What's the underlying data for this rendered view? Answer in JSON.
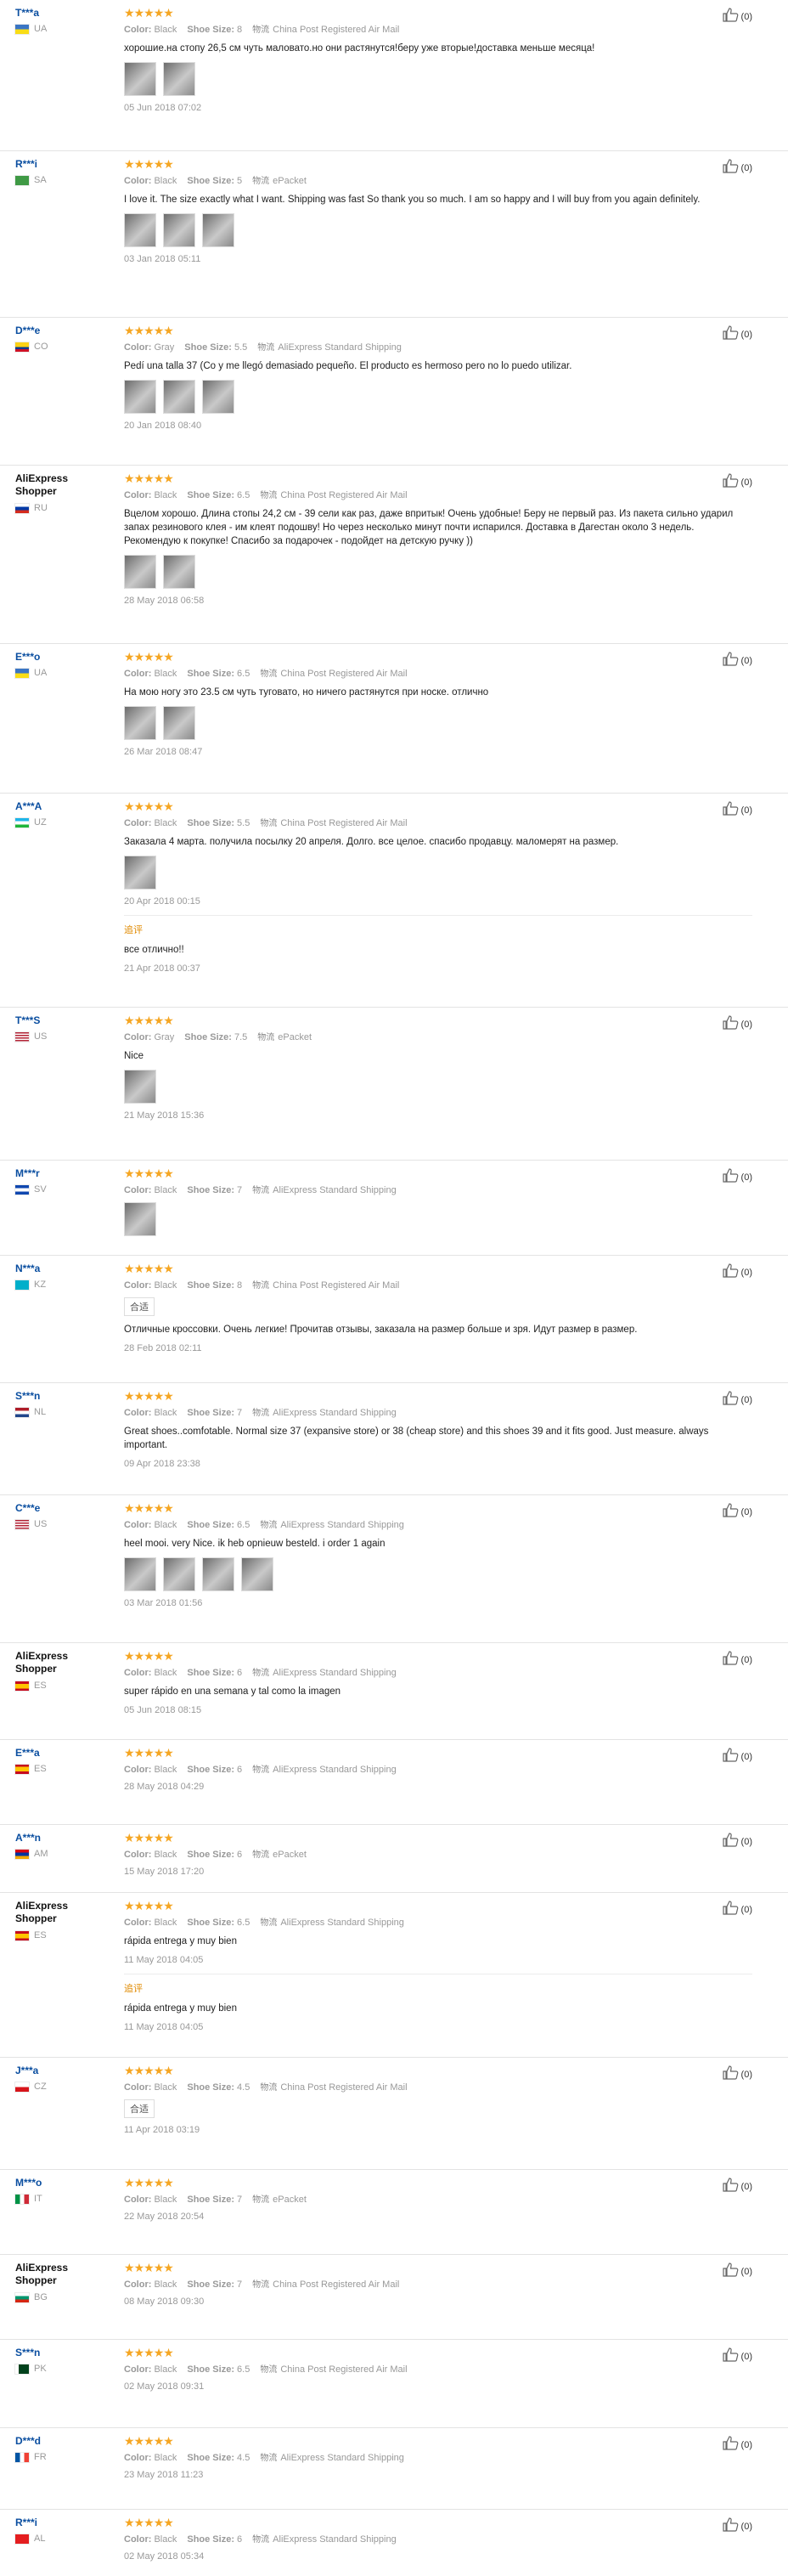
{
  "labels": {
    "color": "Color:",
    "size": "Shoe Size:",
    "ship_icon": "物流",
    "additional": "追评",
    "like_count": "(0)"
  },
  "colors": {
    "star": "#f5a623",
    "user_link": "#0a4ea0",
    "meta": "#999999"
  },
  "reviews": [
    {
      "user": "T***a",
      "country": "UA",
      "flag": "ua",
      "color": "Black",
      "size": "8",
      "shipping": "China Post Registered Air Mail",
      "text": "хорошие.на стопу 26,5 см чуть маловато.но они растянутся!беру уже вторые!доставка меньше месяца!",
      "photos": 2,
      "date": "05 Jun 2018 07:02"
    },
    {
      "user": "R***i",
      "country": "SA",
      "flag": "sa",
      "color": "Black",
      "size": "5",
      "shipping": "ePacket",
      "text": "I love it. The size exactly what I want. Shipping was fast So thank you so much. I am so happy and I will buy from you again definitely.",
      "photos": 3,
      "date": "03 Jan 2018 05:11"
    },
    {
      "user": "D***e",
      "country": "CO",
      "flag": "co",
      "color": "Gray",
      "size": "5.5",
      "shipping": "AliExpress Standard Shipping",
      "text": "Pedí una talla 37 (Co y me llegó demasiado pequeño. El producto es hermoso pero no lo puedo utilizar.",
      "photos": 3,
      "date": "20 Jan 2018 08:40"
    },
    {
      "user": "AliExpress Shopper",
      "country": "RU",
      "flag": "ru",
      "color": "Black",
      "size": "6.5",
      "shipping": "China Post Registered Air Mail",
      "text": "Вцелом хорошо. Длина стопы 24,2 см - 39 сели как раз, даже впритык! Очень удобные! Беру не первый раз. Из пакета сильно ударил запах резинового клея - им клеят подошву! Но через несколько минут почти испарился. Доставка в Дагестан около 3 недель. Рекомендую к покупке! Спасибо за подарочек - подойдет на детскую ручку ))",
      "photos": 2,
      "date": "28 May 2018 06:58"
    },
    {
      "user": "E***o",
      "country": "UA",
      "flag": "ua",
      "color": "Black",
      "size": "6.5",
      "shipping": "China Post Registered Air Mail",
      "text": "На мою ногу это 23.5 см чуть туговато, но ничего растянутся при носке. отлично",
      "photos": 2,
      "date": "26 Mar 2018 08:47"
    },
    {
      "user": "A***A",
      "country": "UZ",
      "flag": "uz",
      "color": "Black",
      "size": "5.5",
      "shipping": "China Post Registered Air Mail",
      "text": "Заказала 4 марта. получила посылку 20 апреля. Долго. все целое. спасибо продавцу. маломерят на размер.",
      "photos": 1,
      "date": "20 Apr 2018 00:15",
      "additional_text": "все отлично!!",
      "additional_date": "21 Apr 2018 00:37"
    },
    {
      "user": "T***S",
      "country": "US",
      "flag": "us",
      "color": "Gray",
      "size": "7.5",
      "shipping": "ePacket",
      "text": "Nice",
      "photos": 1,
      "date": "21 May 2018 15:36"
    },
    {
      "user": "M***r",
      "country": "SV",
      "flag": "sv",
      "color": "Black",
      "size": "7",
      "shipping": "AliExpress Standard Shipping",
      "text": "",
      "photos": 1,
      "date": ""
    },
    {
      "user": "N***a",
      "country": "KZ",
      "flag": "kz",
      "color": "Black",
      "size": "8",
      "shipping": "China Post Registered Air Mail",
      "tag": "合适",
      "text": "Отличные кроссовки. Очень легкие! Прочитав отзывы, заказала на размер больше и зря. Идут размер в размер.",
      "photos": 0,
      "date": "28 Feb 2018 02:11"
    },
    {
      "user": "S***n",
      "country": "NL",
      "flag": "nl",
      "color": "Black",
      "size": "7",
      "shipping": "AliExpress Standard Shipping",
      "text": "Great shoes..comfotable. Normal size 37 (expansive store) or 38 (cheap store) and this shoes 39 and it fits good. Just measure. always important.",
      "photos": 0,
      "date": "09 Apr 2018 23:38"
    },
    {
      "user": "C***e",
      "country": "US",
      "flag": "us",
      "color": "Black",
      "size": "6.5",
      "shipping": "AliExpress Standard Shipping",
      "text": "heel mooi. very Nice. ik heb opnieuw besteld. i order 1 again",
      "photos": 4,
      "date": "03 Mar 2018 01:56"
    },
    {
      "user": "AliExpress Shopper",
      "country": "ES",
      "flag": "es",
      "color": "Black",
      "size": "6",
      "shipping": "AliExpress Standard Shipping",
      "text": "super rápido en una semana y tal como la imagen",
      "photos": 0,
      "date": "05 Jun 2018 08:15"
    },
    {
      "user": "E***a",
      "country": "ES",
      "flag": "es",
      "color": "Black",
      "size": "6",
      "shipping": "AliExpress Standard Shipping",
      "text": "",
      "photos": 0,
      "date": "28 May 2018 04:29"
    },
    {
      "user": "A***n",
      "country": "AM",
      "flag": "am",
      "color": "Black",
      "size": "6",
      "shipping": "ePacket",
      "text": "",
      "photos": 0,
      "date": "15 May 2018 17:20"
    },
    {
      "user": "AliExpress Shopper",
      "country": "ES",
      "flag": "es",
      "color": "Black",
      "size": "6.5",
      "shipping": "AliExpress Standard Shipping",
      "text": "rápida entrega y muy bien",
      "photos": 0,
      "date": "11 May 2018 04:05",
      "additional_text": "rápida entrega y muy bien",
      "additional_date": "11 May 2018 04:05"
    },
    {
      "user": "J***a",
      "country": "CZ",
      "flag": "cz",
      "color": "Black",
      "size": "4.5",
      "shipping": "China Post Registered Air Mail",
      "tag": "合适",
      "text": "",
      "photos": 0,
      "date": "11 Apr 2018 03:19"
    },
    {
      "user": "M***o",
      "country": "IT",
      "flag": "it",
      "color": "Black",
      "size": "7",
      "shipping": "ePacket",
      "text": "",
      "photos": 0,
      "date": "22 May 2018 20:54"
    },
    {
      "user": "AliExpress Shopper",
      "country": "BG",
      "flag": "bg",
      "color": "Black",
      "size": "7",
      "shipping": "China Post Registered Air Mail",
      "text": "",
      "photos": 0,
      "date": "08 May 2018 09:30"
    },
    {
      "user": "S***n",
      "country": "PK",
      "flag": "pk",
      "color": "Black",
      "size": "6.5",
      "shipping": "China Post Registered Air Mail",
      "text": "",
      "photos": 0,
      "date": "02 May 2018 09:31"
    },
    {
      "user": "D***d",
      "country": "FR",
      "flag": "fr",
      "color": "Black",
      "size": "4.5",
      "shipping": "AliExpress Standard Shipping",
      "text": "",
      "photos": 0,
      "date": "23 May 2018 11:23"
    },
    {
      "user": "R***i",
      "country": "AL",
      "flag": "al",
      "color": "Black",
      "size": "6",
      "shipping": "AliExpress Standard Shipping",
      "text": "",
      "photos": 0,
      "date": "02 May 2018 05:34"
    }
  ]
}
